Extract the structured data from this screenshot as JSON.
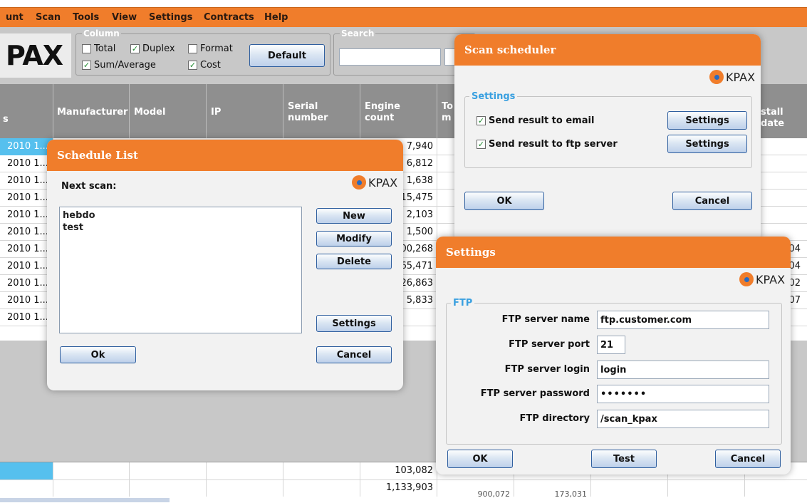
{
  "menu": [
    "unt",
    "Scan",
    "Tools",
    "View",
    "Settings",
    "Contracts",
    "Help"
  ],
  "logo_text": "PAX",
  "column_group": {
    "legend": "Column",
    "total": "Total",
    "duplex": "Duplex",
    "format": "Format",
    "sum_average": "Sum/Average",
    "cost": "Cost",
    "default_button": "Default"
  },
  "search_group": {
    "legend": "Search"
  },
  "table": {
    "headers": {
      "first": "s",
      "manufacturer": "Manufacturer",
      "model": "Model",
      "ip": "IP",
      "serial": "Serial\nnumber",
      "engine": "Engine\ncount",
      "total": "To\nm",
      "install": "stall date"
    },
    "rows": [
      {
        "date": "2010 1...",
        "engine": "7,940"
      },
      {
        "date": "2010 1...",
        "engine": "6,812"
      },
      {
        "date": "2010 1...",
        "engine": "1,638"
      },
      {
        "date": "2010 1...",
        "engine": "15,475"
      },
      {
        "date": "2010 1...",
        "engine": "2,103"
      },
      {
        "date": "2010 1...",
        "engine": "1,500"
      },
      {
        "date": "2010 1...",
        "engine": "00,268",
        "install": "04"
      },
      {
        "date": "2010 1...",
        "engine": "65,471",
        "install": "04"
      },
      {
        "date": "2010 1...",
        "engine": "26,863",
        "install": "02"
      },
      {
        "date": "2010 1...",
        "engine": "5,833",
        "install": "07"
      },
      {
        "date": "2010 1...",
        "engine": ""
      }
    ],
    "totals": [
      "103,082",
      "1,133,903"
    ],
    "partial_bottom": [
      "900,072",
      "173,031"
    ]
  },
  "schedule_list": {
    "title": "Schedule List",
    "next_scan_label": "Next scan:",
    "logo": "KPAX",
    "items": [
      "hebdo",
      "test"
    ],
    "buttons": {
      "new": "New",
      "modify": "Modify",
      "delete": "Delete",
      "settings": "Settings",
      "ok": "Ok",
      "cancel": "Cancel"
    }
  },
  "scan_scheduler": {
    "title": "Scan scheduler",
    "logo": "KPAX",
    "group_legend": "Settings",
    "email_label": "Send result to email",
    "ftp_label": "Send result to ftp server",
    "email_settings": "Settings",
    "ftp_settings": "Settings",
    "ok": "OK",
    "cancel": "Cancel"
  },
  "settings_dialog": {
    "title": "Settings",
    "logo": "KPAX",
    "group_legend": "FTP",
    "fields": {
      "name_label": "FTP server name",
      "name_value": "ftp.customer.com",
      "port_label": "FTP server port",
      "port_value": "21",
      "login_label": "FTP server login",
      "login_value": "login",
      "password_label": "FTP server password",
      "password_value": "•••••••",
      "dir_label": "FTP directory",
      "dir_value": "/scan_kpax"
    },
    "ok": "OK",
    "test": "Test",
    "cancel": "Cancel"
  },
  "colors": {
    "accent_orange": "#f07d2b",
    "toolbar_gray": "#c8c8c8",
    "header_gray": "#8f8f8f",
    "selection_blue": "#56c0ee",
    "legend_blue": "#3aa0e0"
  }
}
